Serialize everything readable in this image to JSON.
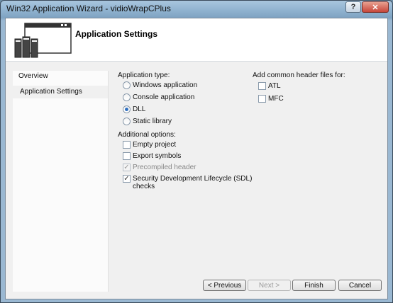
{
  "window": {
    "title": "Win32 Application Wizard - vidioWrapCPlus",
    "help_label": "?",
    "close_label": "✕"
  },
  "header": {
    "title": "Application Settings"
  },
  "nav": {
    "items": [
      {
        "label": "Overview"
      },
      {
        "label": "Application Settings"
      }
    ]
  },
  "application_type": {
    "label": "Application type:",
    "options": [
      {
        "label": "Windows application",
        "selected": false
      },
      {
        "label": "Console application",
        "selected": false
      },
      {
        "label": "DLL",
        "selected": true
      },
      {
        "label": "Static library",
        "selected": false
      }
    ]
  },
  "additional_options": {
    "label": "Additional options:",
    "options": [
      {
        "label": "Empty project",
        "checked": false,
        "enabled": true
      },
      {
        "label": "Export symbols",
        "checked": false,
        "enabled": true
      },
      {
        "label": "Precompiled header",
        "checked": true,
        "enabled": false
      },
      {
        "label_line1": "Security Development Lifecycle (SDL)",
        "label_line2": "checks",
        "checked": true,
        "enabled": true
      }
    ]
  },
  "common_headers": {
    "label": "Add common header files for:",
    "options": [
      {
        "label": "ATL",
        "checked": false
      },
      {
        "label": "MFC",
        "checked": false
      }
    ]
  },
  "buttons": {
    "previous": "< Previous",
    "next": "Next >",
    "finish": "Finish",
    "cancel": "Cancel"
  }
}
